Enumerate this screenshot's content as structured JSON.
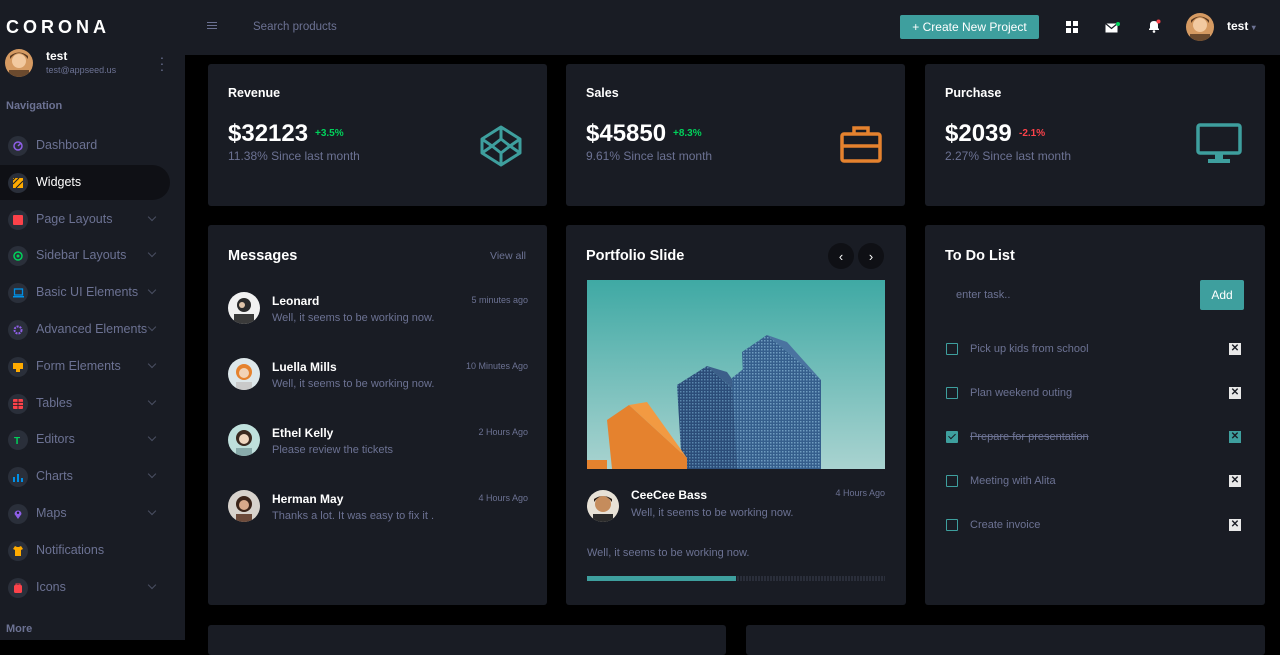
{
  "brand": "CORONA",
  "sidebar": {
    "profile": {
      "name": "test",
      "email": "test@appseed.us"
    },
    "nav_heading": "Navigation",
    "items": [
      {
        "label": "Dashboard",
        "icon": "speedometer-icon",
        "color": "#8f5fe8",
        "chevron": false
      },
      {
        "label": "Widgets",
        "icon": "stripes-icon",
        "color": "#ffab00",
        "chevron": false,
        "active": true
      },
      {
        "label": "Page Layouts",
        "icon": "layout-icon",
        "color": "#fc424a",
        "chevron": true
      },
      {
        "label": "Sidebar Layouts",
        "icon": "compass-icon",
        "color": "#00d25b",
        "chevron": true
      },
      {
        "label": "Basic UI Elements",
        "icon": "laptop-icon",
        "color": "#0090e7",
        "chevron": true
      },
      {
        "label": "Advanced Elements",
        "icon": "gear-icon",
        "color": "#8f5fe8",
        "chevron": true
      },
      {
        "label": "Form Elements",
        "icon": "form-icon",
        "color": "#ffab00",
        "chevron": true
      },
      {
        "label": "Tables",
        "icon": "table-icon",
        "color": "#fc424a",
        "chevron": true
      },
      {
        "label": "Editors",
        "icon": "editor-icon",
        "color": "#00d25b",
        "chevron": true
      },
      {
        "label": "Charts",
        "icon": "chart-icon",
        "color": "#0090e7",
        "chevron": true
      },
      {
        "label": "Maps",
        "icon": "map-pin-icon",
        "color": "#8f5fe8",
        "chevron": true
      },
      {
        "label": "Notifications",
        "icon": "shirt-icon",
        "color": "#ffab00",
        "chevron": false
      },
      {
        "label": "Icons",
        "icon": "bag-icon",
        "color": "#fc424a",
        "chevron": true
      }
    ],
    "more_heading": "More"
  },
  "topbar": {
    "search_placeholder": "Search products",
    "create_label": "+ Create New Project",
    "user_name": "test"
  },
  "stats": [
    {
      "title": "Revenue",
      "value": "$32123",
      "change": "+3.5%",
      "change_color": "#00d25b",
      "sub": "11.38% Since last month",
      "icon": "codepen-icon",
      "icon_color": "#3e9f9e"
    },
    {
      "title": "Sales",
      "value": "$45850",
      "change": "+8.3%",
      "change_color": "#00d25b",
      "sub": "9.61% Since last month",
      "icon": "briefcase-icon",
      "icon_color": "#e5822e"
    },
    {
      "title": "Purchase",
      "value": "$2039",
      "change": "-2.1%",
      "change_color": "#fc424a",
      "sub": "2.27% Since last month",
      "icon": "monitor-icon",
      "icon_color": "#3e9f9e"
    }
  ],
  "messages": {
    "title": "Messages",
    "view_all": "View all",
    "items": [
      {
        "name": "Leonard",
        "text": "Well, it seems to be working now.",
        "time": "5 minutes ago"
      },
      {
        "name": "Luella Mills",
        "text": "Well, it seems to be working now.",
        "time": "10 Minutes Ago"
      },
      {
        "name": "Ethel Kelly",
        "text": "Please review the tickets",
        "time": "2 Hours Ago"
      },
      {
        "name": "Herman May",
        "text": "Thanks a lot. It was easy to fix it .",
        "time": "4 Hours Ago"
      }
    ]
  },
  "portfolio": {
    "title": "Portfolio Slide",
    "author": "CeeCee Bass",
    "author_text": "Well, it seems to be working now.",
    "time": "4 Hours Ago",
    "caption": "Well, it seems to be working now.",
    "progress": 0.5
  },
  "todo": {
    "title": "To Do List",
    "input_placeholder": "enter task..",
    "add_label": "Add",
    "items": [
      {
        "label": "Pick up kids from school",
        "done": false
      },
      {
        "label": "Plan weekend outing",
        "done": false
      },
      {
        "label": "Prepare for presentation",
        "done": true
      },
      {
        "label": "Meeting with Alita",
        "done": false
      },
      {
        "label": "Create invoice",
        "done": false
      }
    ],
    "remove_glyph": "✕"
  }
}
